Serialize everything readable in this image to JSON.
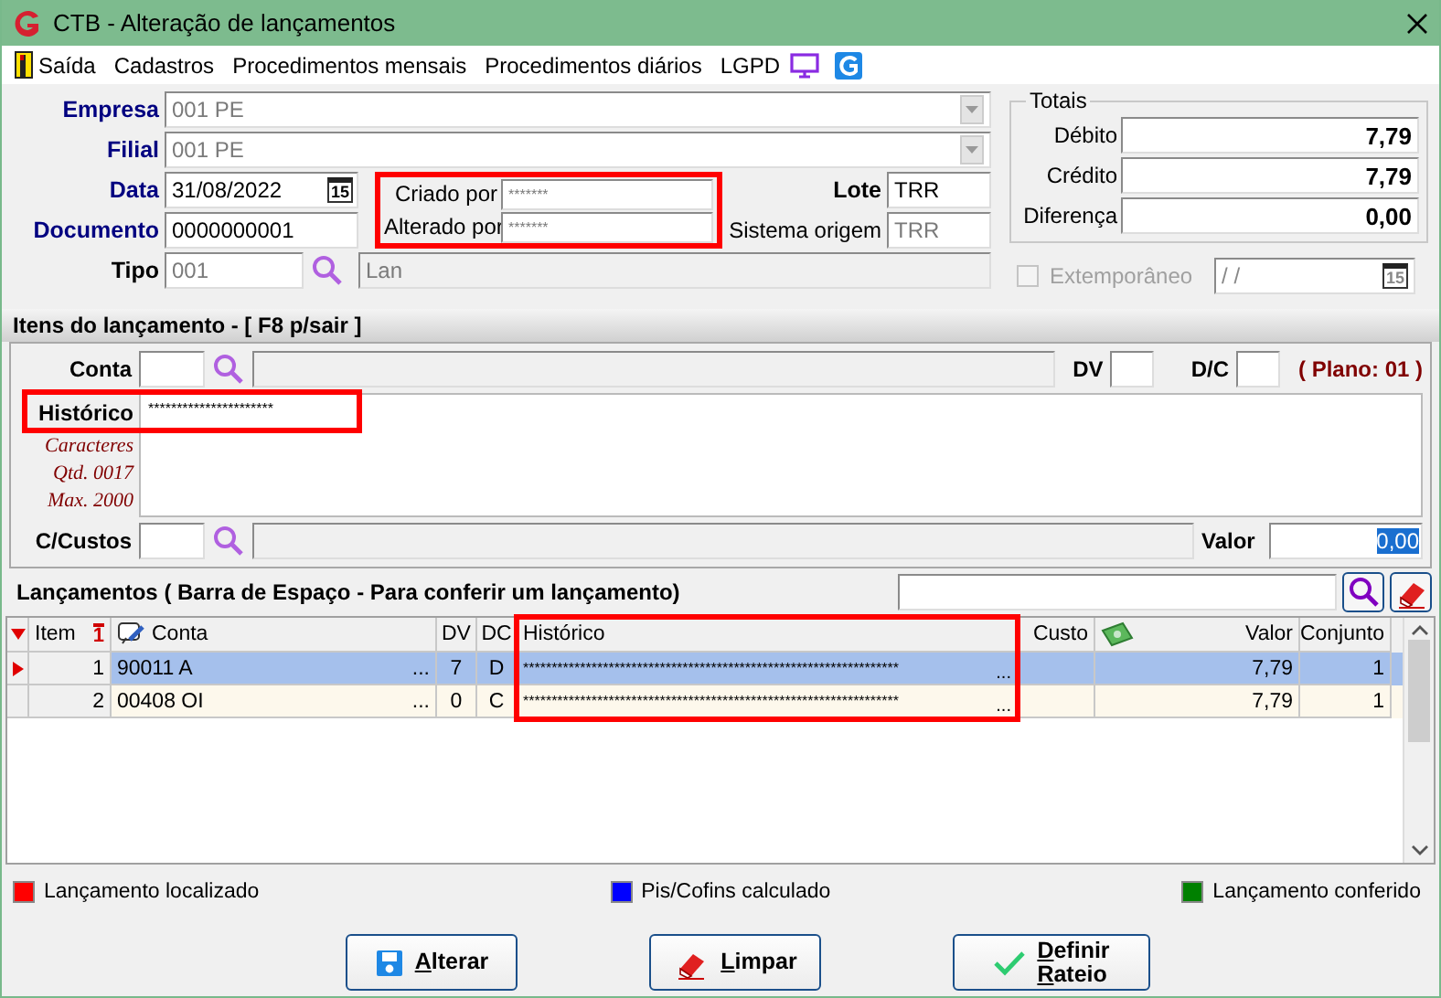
{
  "window": {
    "title": "CTB - Alteração de lançamentos"
  },
  "menu": [
    {
      "label": "Saída",
      "kind": "exit"
    },
    {
      "label": "Cadastros",
      "kind": "plain"
    },
    {
      "label": "Procedimentos mensais",
      "kind": "plain"
    },
    {
      "label": "Procedimentos diários",
      "kind": "plain"
    },
    {
      "label": "LGPD",
      "kind": "plain"
    }
  ],
  "header": {
    "empresa": {
      "label": "Empresa",
      "value": "001 PE",
      "disabled": true
    },
    "filial": {
      "label": "Filial",
      "value": "001 PE",
      "disabled": true
    },
    "data": {
      "label": "Data",
      "value": "31/08/2022",
      "calendar": "15"
    },
    "documento": {
      "label": "Documento",
      "value": "0000000001"
    },
    "tipo": {
      "label": "Tipo",
      "code": "001",
      "description": "Lan"
    },
    "audit": {
      "highlighted": true,
      "fields": [
        {
          "label": "Criado por",
          "value": "*******"
        },
        {
          "label": "Alterado por",
          "value": "*******"
        }
      ]
    },
    "lote": {
      "label": "Lote",
      "value": "TRR"
    },
    "sistema_origem": {
      "label": "Sistema origem",
      "value": "TRR"
    }
  },
  "totais": {
    "title": "Totais",
    "rows": [
      {
        "label": "Débito",
        "value": "7,79"
      },
      {
        "label": "Crédito",
        "value": "7,79"
      },
      {
        "label": "Diferença",
        "value": "0,00"
      }
    ]
  },
  "extemporaneo": {
    "label": "Extemporâneo",
    "checked": false,
    "disabled": true,
    "date": "/ /",
    "calendar": "15"
  },
  "items": {
    "title": "Itens do lançamento - [ F8 p/sair ]",
    "conta_label": "Conta",
    "dv_label": "DV",
    "dc_label": "D/C",
    "plano": "( Plano: 01 )",
    "historico": {
      "label": "Histórico",
      "value": "**********************",
      "highlighted": true
    },
    "counter": [
      "Caracteres",
      "Qtd. 0017",
      "Max. 2000"
    ],
    "custos_label": "C/Custos",
    "valor": {
      "label": "Valor",
      "value": "0,00",
      "text_selected": true
    }
  },
  "lancamentos": {
    "title": "Lançamentos ( Barra de Espaço - Para conferir um lançamento)",
    "historico_highlighted": true,
    "columns": [
      {
        "label": "Item",
        "kind": "item",
        "sort": "1"
      },
      {
        "label": "Conta",
        "kind": "conta"
      },
      {
        "label": "DV",
        "kind": "dv"
      },
      {
        "label": "DC",
        "kind": "dc"
      },
      {
        "label": "Histórico",
        "kind": "historico"
      },
      {
        "label": "Custo",
        "kind": "custo"
      },
      {
        "label": "Valor",
        "kind": "valor"
      },
      {
        "label": "Conjunto",
        "kind": "conjunto"
      }
    ],
    "rows": [
      {
        "selected": true,
        "item": "1",
        "conta": "90011 A",
        "conta_more": "...",
        "dv": "7",
        "dc": "D",
        "historico": "******************************************************************",
        "historico_more": "...",
        "valor": "7,79",
        "conjunto": "1"
      },
      {
        "selected": false,
        "item": "2",
        "conta": "00408 OI",
        "conta_more": "...",
        "dv": "0",
        "dc": "C",
        "historico": "******************************************************************",
        "historico_more": "...",
        "valor": "7,79",
        "conjunto": "1"
      }
    ]
  },
  "legend": [
    {
      "label": "Lançamento localizado",
      "color": "#ff0000"
    },
    {
      "label": "Pis/Cofins calculado",
      "color": "#0000ff"
    },
    {
      "label": "Lançamento conferido",
      "color": "#008000"
    }
  ],
  "buttons": [
    {
      "lines": [
        "Alterar"
      ],
      "kind": "save"
    },
    {
      "lines": [
        "Limpar"
      ],
      "kind": "eraser"
    },
    {
      "lines": [
        "Definir",
        "Rateio"
      ],
      "kind": "check"
    }
  ]
}
